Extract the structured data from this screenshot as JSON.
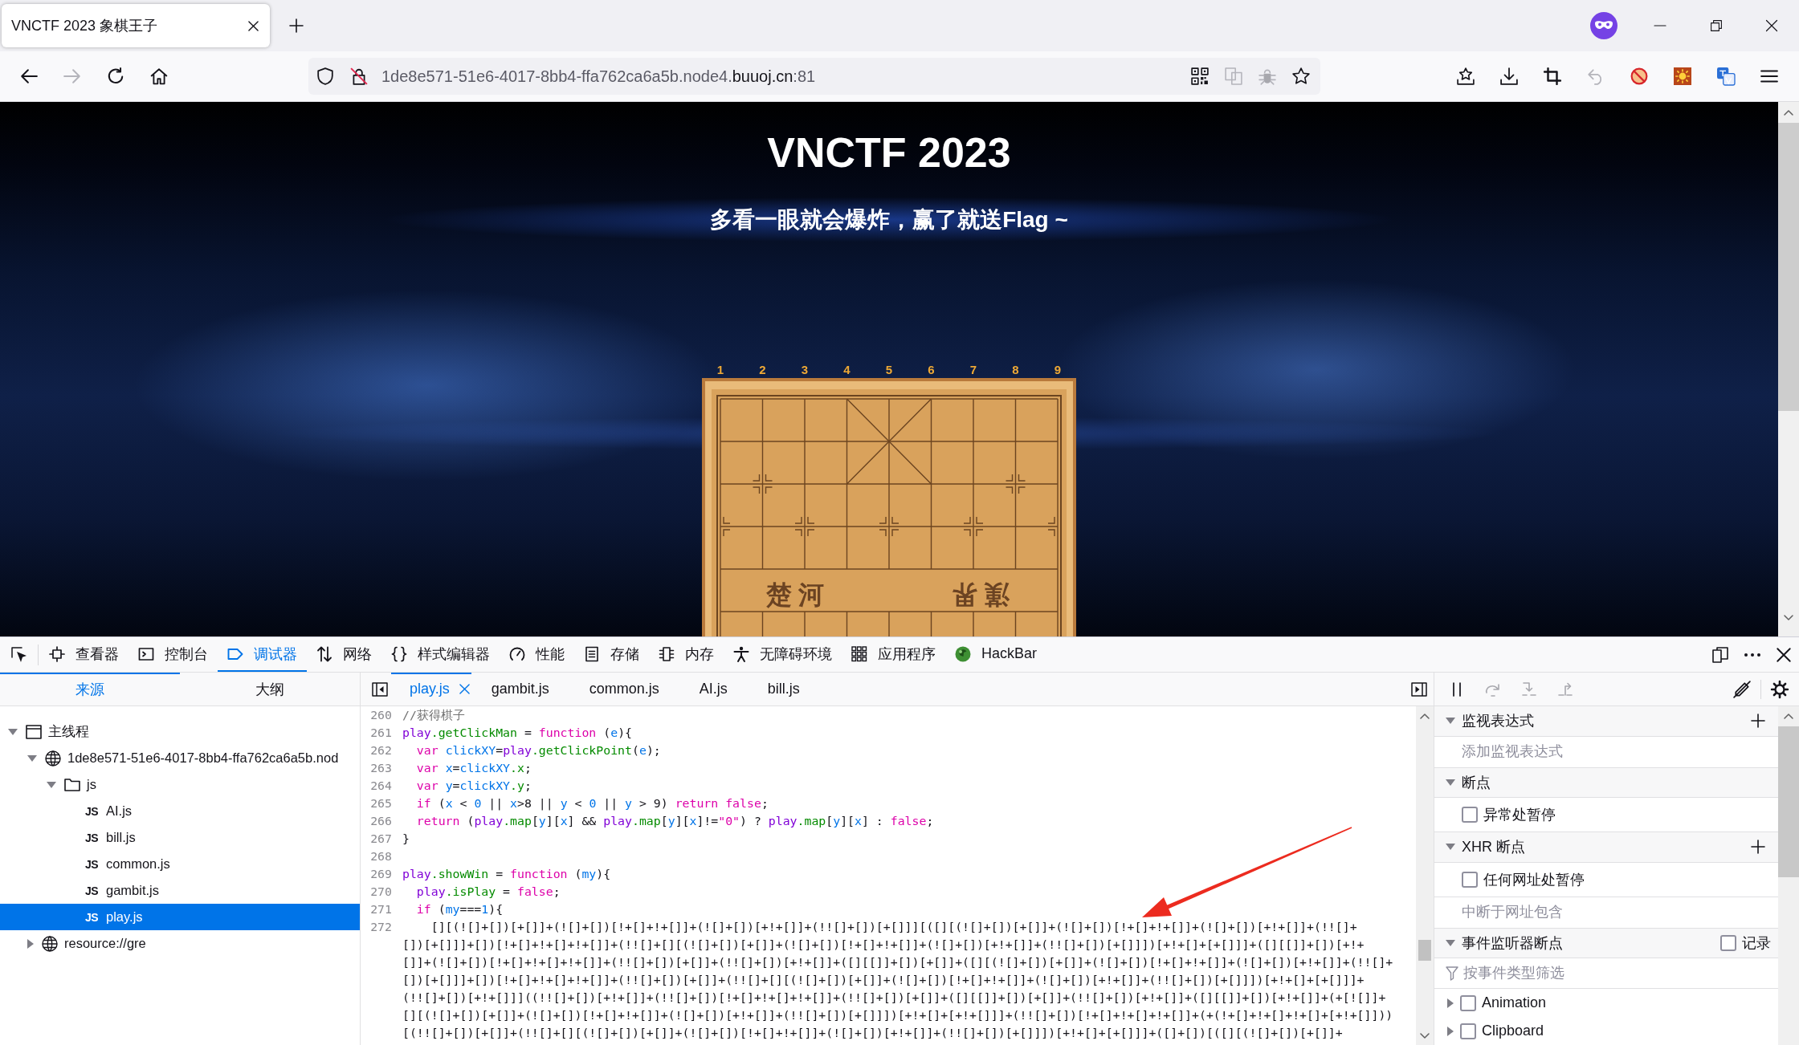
{
  "browser": {
    "tabs": [
      {
        "title": "VNCTF 2023 象棋王子",
        "selected": true
      }
    ],
    "nav_buttons": [
      {
        "kind": "back",
        "disabled": false
      },
      {
        "kind": "forward",
        "disabled": true
      },
      {
        "kind": "reload",
        "disabled": false
      },
      {
        "kind": "home",
        "disabled": false
      }
    ],
    "url": {
      "subdomain": "1de8e571-51e6-4017-8bb4-ffa762ca6a5b.node4.",
      "domain": "buuoj.cn",
      "port": ":81"
    }
  },
  "page": {
    "title": "VNCTF 2023",
    "subtitle": "多看一眼就会爆炸，赢了就送Flag ~",
    "board": {
      "column_numbers": [
        "1",
        "2",
        "3",
        "4",
        "5",
        "6",
        "7",
        "8",
        "9"
      ],
      "river": [
        "楚河",
        "漢界"
      ]
    }
  },
  "devtools": {
    "toolbox_tabs": [
      {
        "kind": "inspector",
        "label": "查看器",
        "selected": false
      },
      {
        "kind": "console",
        "label": "控制台",
        "selected": false
      },
      {
        "kind": "debugger",
        "label": "调试器",
        "selected": true
      },
      {
        "kind": "network",
        "label": "网络",
        "selected": false
      },
      {
        "kind": "style",
        "label": "样式编辑器",
        "selected": false
      },
      {
        "kind": "performance",
        "label": "性能",
        "selected": false
      },
      {
        "kind": "storage",
        "label": "存储",
        "selected": false
      },
      {
        "kind": "memory",
        "label": "内存",
        "selected": false
      },
      {
        "kind": "accessibility",
        "label": "无障碍环境",
        "selected": false
      },
      {
        "kind": "application",
        "label": "应用程序",
        "selected": false
      },
      {
        "kind": "hackbar",
        "label": "HackBar",
        "selected": false
      }
    ],
    "source_tabs": [
      {
        "label": "来源",
        "selected": true
      },
      {
        "label": "大纲",
        "selected": false
      }
    ],
    "tree": [
      {
        "kind": "thread",
        "label": "主线程",
        "expanded": true,
        "selected": false,
        "children": [
          {
            "kind": "domain",
            "label": "1de8e571-51e6-4017-8bb4-ffa762ca6a5b.nod",
            "expanded": true,
            "selected": false,
            "children": [
              {
                "kind": "folder",
                "label": "js",
                "expanded": true,
                "selected": false,
                "children": [
                  {
                    "kind": "file",
                    "badge": "JS",
                    "label": "AI.js",
                    "selected": false
                  },
                  {
                    "kind": "file",
                    "badge": "JS",
                    "label": "bill.js",
                    "selected": false
                  },
                  {
                    "kind": "file",
                    "badge": "JS",
                    "label": "common.js",
                    "selected": false
                  },
                  {
                    "kind": "file",
                    "badge": "JS",
                    "label": "gambit.js",
                    "selected": false
                  },
                  {
                    "kind": "file",
                    "badge": "JS",
                    "label": "play.js",
                    "selected": true
                  }
                ]
              }
            ]
          },
          {
            "kind": "domain",
            "label": "resource://gre",
            "expanded": false,
            "selected": false
          }
        ]
      }
    ],
    "editor_tabs": [
      {
        "label": "play.js",
        "selected": true
      },
      {
        "label": "gambit.js",
        "selected": false
      },
      {
        "label": "common.js",
        "selected": false
      },
      {
        "label": "AI.js",
        "selected": false
      },
      {
        "label": "bill.js",
        "selected": false
      }
    ],
    "code": [
      {
        "number": "260",
        "tokens": [
          {
            "kind": "comment",
            "text": "//获得棋子"
          }
        ]
      },
      {
        "number": "261",
        "tokens": [
          {
            "kind": "object",
            "text": "play"
          },
          {
            "kind": "property",
            "text": ".getClickMan"
          },
          {
            "kind": "plain",
            "text": " = "
          },
          {
            "kind": "keyword",
            "text": "function"
          },
          {
            "kind": "plain",
            "text": " ("
          },
          {
            "kind": "variable",
            "text": "e"
          },
          {
            "kind": "plain",
            "text": "){"
          }
        ]
      },
      {
        "number": "262",
        "tokens": [
          {
            "kind": "keyword",
            "text": "  var "
          },
          {
            "kind": "variable",
            "text": "clickXY"
          },
          {
            "kind": "plain",
            "text": "="
          },
          {
            "kind": "object",
            "text": "play"
          },
          {
            "kind": "property",
            "text": ".getClickPoint"
          },
          {
            "kind": "plain",
            "text": "("
          },
          {
            "kind": "variable",
            "text": "e"
          },
          {
            "kind": "plain",
            "text": ");"
          }
        ]
      },
      {
        "number": "263",
        "tokens": [
          {
            "kind": "keyword",
            "text": "  var "
          },
          {
            "kind": "variable",
            "text": "x"
          },
          {
            "kind": "plain",
            "text": "="
          },
          {
            "kind": "variable",
            "text": "clickXY"
          },
          {
            "kind": "property",
            "text": ".x"
          },
          {
            "kind": "plain",
            "text": ";"
          }
        ]
      },
      {
        "number": "264",
        "tokens": [
          {
            "kind": "keyword",
            "text": "  var "
          },
          {
            "kind": "variable",
            "text": "y"
          },
          {
            "kind": "plain",
            "text": "="
          },
          {
            "kind": "variable",
            "text": "clickXY"
          },
          {
            "kind": "property",
            "text": ".y"
          },
          {
            "kind": "plain",
            "text": ";"
          }
        ]
      },
      {
        "number": "265",
        "tokens": [
          {
            "kind": "keyword",
            "text": "  if"
          },
          {
            "kind": "plain",
            "text": " ("
          },
          {
            "kind": "variable",
            "text": "x"
          },
          {
            "kind": "plain",
            "text": " < "
          },
          {
            "kind": "number",
            "text": "0"
          },
          {
            "kind": "plain",
            "text": " || "
          },
          {
            "kind": "variable",
            "text": "x"
          },
          {
            "kind": "plain",
            "text": ">8 || "
          },
          {
            "kind": "variable",
            "text": "y"
          },
          {
            "kind": "plain",
            "text": " < "
          },
          {
            "kind": "number",
            "text": "0"
          },
          {
            "kind": "plain",
            "text": " || "
          },
          {
            "kind": "variable",
            "text": "y"
          },
          {
            "kind": "plain",
            "text": " > 9) "
          },
          {
            "kind": "keyword",
            "text": "return "
          },
          {
            "kind": "atom",
            "text": "false"
          },
          {
            "kind": "plain",
            "text": ";"
          }
        ]
      },
      {
        "number": "266",
        "tokens": [
          {
            "kind": "keyword",
            "text": "  return"
          },
          {
            "kind": "plain",
            "text": " ("
          },
          {
            "kind": "object",
            "text": "play"
          },
          {
            "kind": "property",
            "text": ".map"
          },
          {
            "kind": "plain",
            "text": "["
          },
          {
            "kind": "variable",
            "text": "y"
          },
          {
            "kind": "plain",
            "text": "]["
          },
          {
            "kind": "variable",
            "text": "x"
          },
          {
            "kind": "plain",
            "text": "] && "
          },
          {
            "kind": "object",
            "text": "play"
          },
          {
            "kind": "property",
            "text": ".map"
          },
          {
            "kind": "plain",
            "text": "["
          },
          {
            "kind": "variable",
            "text": "y"
          },
          {
            "kind": "plain",
            "text": "]["
          },
          {
            "kind": "variable",
            "text": "x"
          },
          {
            "kind": "plain",
            "text": "]!="
          },
          {
            "kind": "string",
            "text": "\"0\""
          },
          {
            "kind": "plain",
            "text": ") ? "
          },
          {
            "kind": "object",
            "text": "play"
          },
          {
            "kind": "property",
            "text": ".map"
          },
          {
            "kind": "plain",
            "text": "["
          },
          {
            "kind": "variable",
            "text": "y"
          },
          {
            "kind": "plain",
            "text": "]["
          },
          {
            "kind": "variable",
            "text": "x"
          },
          {
            "kind": "plain",
            "text": "] : "
          },
          {
            "kind": "atom",
            "text": "false"
          },
          {
            "kind": "plain",
            "text": ";"
          }
        ]
      },
      {
        "number": "267",
        "tokens": [
          {
            "kind": "plain",
            "text": "}"
          }
        ]
      },
      {
        "number": "268"
      },
      {
        "number": "269",
        "tokens": [
          {
            "kind": "object",
            "text": "play"
          },
          {
            "kind": "property",
            "text": ".showWin"
          },
          {
            "kind": "plain",
            "text": " = "
          },
          {
            "kind": "keyword",
            "text": "function"
          },
          {
            "kind": "plain",
            "text": " ("
          },
          {
            "kind": "variable",
            "text": "my"
          },
          {
            "kind": "plain",
            "text": "){"
          }
        ]
      },
      {
        "number": "270",
        "tokens": [
          {
            "kind": "object",
            "text": "  play"
          },
          {
            "kind": "property",
            "text": ".isPlay"
          },
          {
            "kind": "plain",
            "text": " = "
          },
          {
            "kind": "atom",
            "text": "false"
          },
          {
            "kind": "plain",
            "text": ";"
          }
        ]
      },
      {
        "number": "271",
        "tokens": [
          {
            "kind": "keyword",
            "text": "  if"
          },
          {
            "kind": "plain",
            "text": " ("
          },
          {
            "kind": "variable",
            "text": "my"
          },
          {
            "kind": "plain",
            "text": "==="
          },
          {
            "kind": "number",
            "text": "1"
          },
          {
            "kind": "plain",
            "text": "){"
          }
        ]
      },
      {
        "number": "272",
        "rows": [
          "    [][(![]+[])[+[]]+(![]+[])[!+[]+!+[]]+(![]+[])[+!+[]]+(!![]+[])[+[]]][([][(![]+[])[+[]]+(![]+[])[!+[]+!+[]]+(![]+[])[+!+[]]+(!![]+",
          "[])[+[]]]+[])[!+[]+!+[]+!+[]]+(!![]+[][(![]+[])[+[]]+(![]+[])[!+[]+!+[]]+(![]+[])[+!+[]]+(!![]+[])[+[]]])[+!+[]+[+[]]]+([][[]]+[])[+!+",
          "[]]+(![]+[])[!+[]+!+[]+!+[]]+(!![]+[])[+[]]+(!![]+[])[+!+[]]+([][[]]+[])[+[]]+([][(![]+[])[+[]]+(![]+[])[!+[]+!+[]]+(![]+[])[+!+[]]+(!![]+",
          "[])[+[]]]+[])[!+[]+!+[]+!+[]]+(!![]+[])[+[]]+(!![]+[][(![]+[])[+[]]+(![]+[])[!+[]+!+[]]+(![]+[])[+!+[]]+(!![]+[])[+[]]])[+!+[]+[+[]]]+",
          "(!![]+[])[+!+[]]]((!![]+[])[+!+[]]+(!![]+[])[!+[]+!+[]+!+[]]+(!![]+[])[+[]]+([][[]]+[])[+[]]+(!![]+[])[+!+[]]+([][[]]+[])[+!+[]]+(+[![]]+",
          "[][(![]+[])[+[]]+(![]+[])[!+[]+!+[]]+(![]+[])[+!+[]]+(!![]+[])[+[]]])[+!+[]+[+!+[]]]+(!![]+[])[!+[]+!+[]+!+[]]+(+(!+[]+!+[]+!+[]+[+!+[]]))",
          "[(!![]+[])[+[]]+(!![]+[][(![]+[])[+[]]+(![]+[])[!+[]+!+[]]+(![]+[])[+!+[]]+(!![]+[])[+[]]])[+!+[]+[+[]]]+([]+[])[([][(![]+[])[+[]]+"
        ]
      }
    ],
    "debug_buttons": [
      {
        "kind": "pause",
        "disabled": false
      },
      {
        "kind": "step_over",
        "disabled": true
      },
      {
        "kind": "step_in",
        "disabled": true
      },
      {
        "kind": "step_out",
        "disabled": true
      }
    ],
    "sidebar": [
      {
        "kind": "section",
        "label": "监视表达式",
        "expanded": true,
        "add": true
      },
      {
        "kind": "input",
        "placeholder": "添加监视表达式"
      },
      {
        "kind": "section",
        "label": "断点",
        "expanded": true
      },
      {
        "kind": "checkbox",
        "label": "异常处暂停",
        "checked": false
      },
      {
        "kind": "section",
        "label": "XHR 断点",
        "expanded": true,
        "add": true
      },
      {
        "kind": "checkbox",
        "label": "任何网址处暂停",
        "checked": false
      },
      {
        "kind": "input",
        "placeholder": "中断于网址包含"
      },
      {
        "kind": "section",
        "label": "事件监听器断点",
        "expanded": true,
        "option": {
          "label": "记录",
          "checked": false
        }
      },
      {
        "kind": "filter",
        "placeholder": "按事件类型筛选"
      },
      {
        "kind": "event",
        "label": "Animation",
        "expanded": false,
        "checked": false
      },
      {
        "kind": "event",
        "label": "Clipboard",
        "expanded": false,
        "checked": false
      }
    ]
  }
}
